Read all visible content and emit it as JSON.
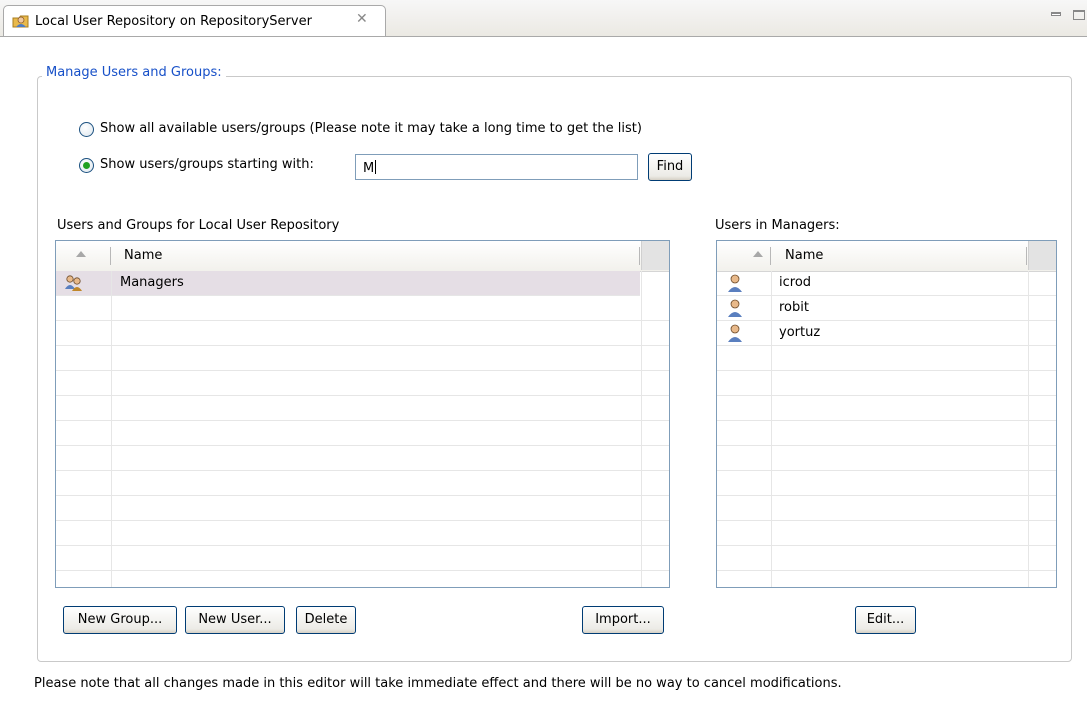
{
  "tab": {
    "title": "Local User Repository on RepositoryServer",
    "close_symbol": "✕",
    "icon": "user-repository-icon"
  },
  "group_title": "Manage Users and Groups:",
  "options": {
    "show_all_label": "Show all available users/groups (Please note it may take a long time to get the list)",
    "show_starting_label": "Show users/groups starting with:",
    "selected": "show_starting",
    "filter_value": "M",
    "find_label": "Find"
  },
  "left_panel": {
    "title": "Users and Groups for Local User Repository",
    "column_header": "Name",
    "rows": [
      {
        "name": "Managers",
        "icon": "group-icon",
        "selected": true
      }
    ],
    "buttons": {
      "new_group": "New Group...",
      "new_user": "New User...",
      "delete": "Delete",
      "import": "Import..."
    }
  },
  "right_panel": {
    "title": "Users in Managers:",
    "column_header": "Name",
    "rows": [
      {
        "name": "icrod",
        "icon": "user-icon"
      },
      {
        "name": "robit",
        "icon": "user-icon"
      },
      {
        "name": "yortuz",
        "icon": "user-icon"
      }
    ],
    "buttons": {
      "edit": "Edit..."
    }
  },
  "footnote": "Please note that all changes made in this editor will take immediate effect and there will be no way to cancel modifications.",
  "colors": {
    "legend": "#1750c8",
    "radio_dot": "#21a121",
    "selection": "#e5dee5"
  }
}
